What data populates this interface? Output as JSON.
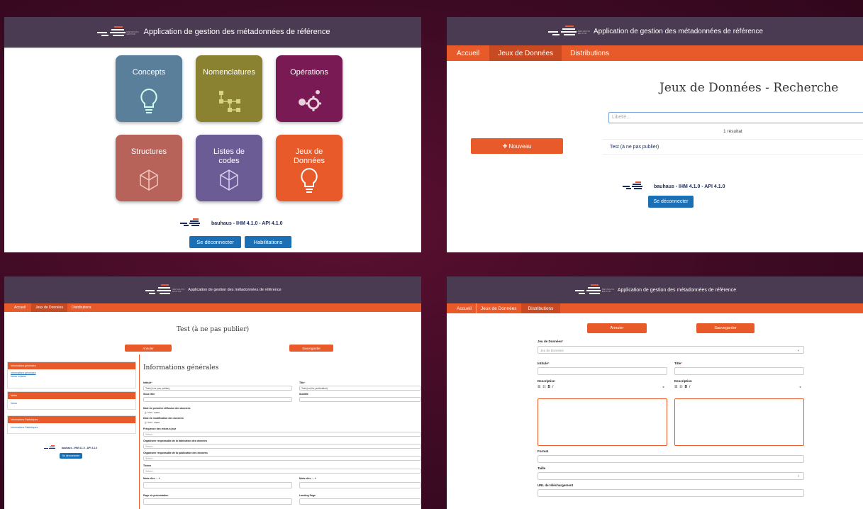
{
  "app_title": "Application de gestion des métadonnées de référence",
  "logo_text": "METADATA EDITOR",
  "version": "bauhaus - IHM 4.1.0 - API 4.1.0",
  "colors": {
    "header": "#4a3a52",
    "nav": "#e85a2a",
    "button_blue": "#1a6fb5"
  },
  "home": {
    "tiles": [
      {
        "label": "Concepts",
        "color": "#5a7f9a",
        "icon": "lightbulb-icon"
      },
      {
        "label": "Nomenclatures",
        "color": "#8a8230",
        "icon": "tree-icon"
      },
      {
        "label": "Opérations",
        "color": "#7a1a55",
        "icon": "gears-icon"
      },
      {
        "label": "Structures",
        "color": "#b8635a",
        "icon": "cube-icon"
      },
      {
        "label": "Listes de codes",
        "color": "#6c5c96",
        "icon": "cube-icon"
      },
      {
        "label": "Jeux de Données",
        "color": "#e85a2a",
        "icon": "lightbulb-icon"
      }
    ],
    "logout": "Se déconnecter",
    "permissions": "Habilitations"
  },
  "nav": {
    "home": "Accueil",
    "datasets": "Jeux de Données",
    "distributions": "Distributions"
  },
  "search": {
    "title": "Jeux de Données - Recherche",
    "placeholder": "Libellé...",
    "result_count": "1 résultat",
    "result": "Test (à ne pas publier)",
    "new_button": "Nouveau",
    "logout": "Se déconnecter"
  },
  "detail": {
    "title": "Test (à ne pas publier)",
    "cancel": "Annuler",
    "save": "Sauvegarder",
    "section_title": "Informations générales",
    "side_groups": [
      {
        "title": "Informations générales",
        "links": [
          "Informations générales",
          "Notes Initiales"
        ]
      },
      {
        "title": "Notes",
        "links": [
          "Notes"
        ]
      },
      {
        "title": "Informations Statistiques",
        "links": [
          "Informations Statistiques"
        ]
      }
    ],
    "labels": {
      "intitule": "Intitulé",
      "title": "Title",
      "intitule_value": "Test (à ne pas publier)",
      "title_value": "Test (not for publication)",
      "sous_titre": "Sous titre",
      "subtitle": "Subtitle",
      "first_diffusion": "Date de première diffusion des données",
      "date_placeholder": "jj / mm / aaaa",
      "modification": "Date de modification des données",
      "frequence": "Fréquence des mises à jour",
      "org_fabrication": "Organisme responsable de la fabrication des données",
      "org_publication": "Organisme responsable de la publication des données",
      "theme": "Thème",
      "select": "Select...",
      "mots_cles": "Mots-clés",
      "keywords": "Mots-clés",
      "page": "Page de présentation",
      "landing": "Landing Page"
    },
    "logout": "Se déconnecter"
  },
  "distribution": {
    "cancel": "Annuler",
    "save": "Sauvegarder",
    "dataset_label": "Jeu de Données",
    "dataset_placeholder": "Jeu de Données",
    "intitule": "Intitulé",
    "title": "Title",
    "description": "Description",
    "format": "Format",
    "taille": "Taille",
    "url": "URL de téléchargement"
  }
}
